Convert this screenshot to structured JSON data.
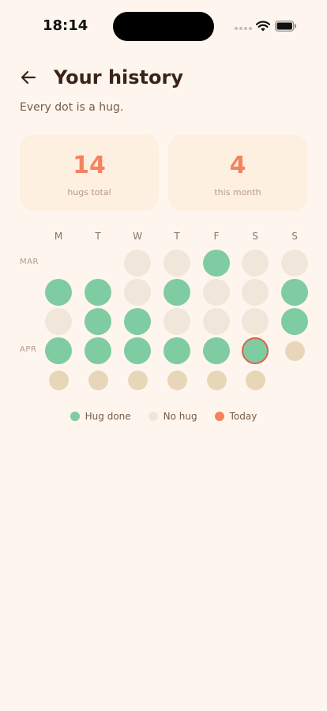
{
  "status_bar": {
    "time": "18:14"
  },
  "header": {
    "title": "Your history",
    "back_icon": "arrow-left-icon"
  },
  "subtitle": "Every dot is a hug.",
  "stats": [
    {
      "value": "14",
      "label": "hugs total"
    },
    {
      "value": "4",
      "label": "this month"
    }
  ],
  "calendar": {
    "day_headers": [
      "M",
      "T",
      "W",
      "T",
      "F",
      "S",
      "S"
    ],
    "months": [
      {
        "label": "MAR",
        "row": 0
      },
      {
        "label": "APR",
        "row": 3
      }
    ],
    "weeks": [
      [
        "",
        "",
        "none",
        "none",
        "done",
        "none",
        "none"
      ],
      [
        "done",
        "done",
        "none",
        "done",
        "none",
        "none",
        "done"
      ],
      [
        "none",
        "done",
        "done",
        "none",
        "none",
        "none",
        "done"
      ],
      [
        "done",
        "done",
        "done",
        "done",
        "done",
        "today",
        "future"
      ],
      [
        "future",
        "future",
        "future",
        "future",
        "future",
        "future",
        ""
      ]
    ]
  },
  "legend": [
    {
      "label": "Hug done",
      "color": "#7FCBA2"
    },
    {
      "label": "No hug",
      "color": "#F1E6DA"
    },
    {
      "label": "Today",
      "color": "#F4845F"
    }
  ],
  "colors": {
    "background": "#FEF6EE",
    "accent": "#F4845F",
    "done": "#7FCBA2",
    "none": "#F1E6DA",
    "future": "#E8D6B8",
    "today_border": "#D9634A"
  }
}
